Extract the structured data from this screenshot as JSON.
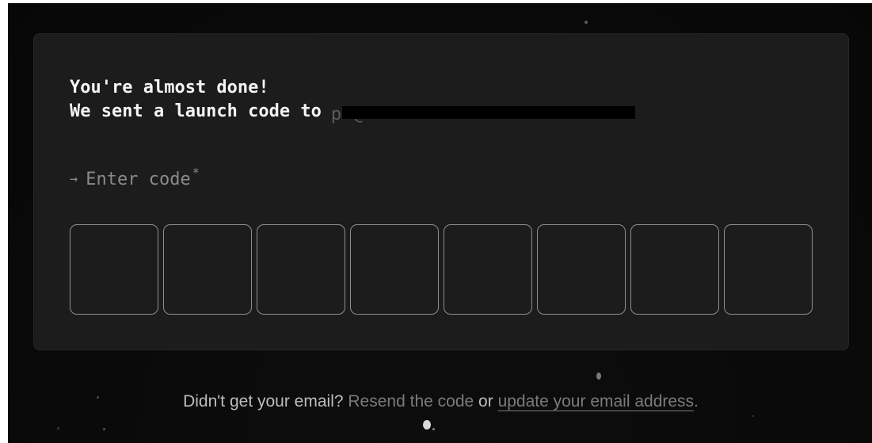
{
  "heading": {
    "line1": "You're almost done!",
    "line2": "We sent a launch code to",
    "email_partial": "p                  @"
  },
  "code_entry": {
    "arrow": "→",
    "label": "Enter code",
    "required_marker": "*",
    "box_count": 8
  },
  "footer": {
    "prompt": "Didn't get your email?",
    "resend_link": "Resend the code",
    "or_text": "or",
    "update_link": "update your email address",
    "period": "."
  }
}
